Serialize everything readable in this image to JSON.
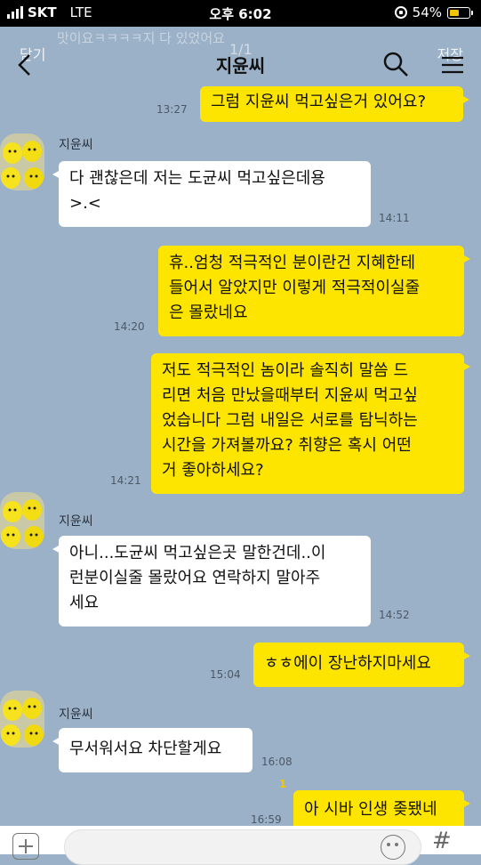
{
  "status_bar": {
    "carrier": "SKT",
    "network": "LTE",
    "time": "오후 6:02",
    "battery_text": "54%",
    "battery_level": 0.54
  },
  "header": {
    "title": "지윤씨",
    "close_label": "닫기",
    "save_label": "저장",
    "counter": "1/1",
    "preview_text": "맛이요ㅋㅋㅋㅋ지 다 있었어요"
  },
  "contact": {
    "name": "지윤씨"
  },
  "messages": [
    {
      "text": "그럼 지윤씨 먹고싶은거 있어요?",
      "time": "13:27"
    },
    {
      "sender": "지윤씨",
      "text": "다 괜찮은데 저는 도균씨 먹고싶은데용\n>.<",
      "time": "14:11"
    },
    {
      "text": "휴..엄청 적극적인 분이란건 지혜한테\n들어서 알았지만 이렇게 적극적이실줄\n은 몰랐네요",
      "time": "14:20"
    },
    {
      "text": "저도 적극적인 놈이라 솔직히 말씀 드\n리면 처음 만났을때부터 지윤씨 먹고싶\n었습니다 그럼 내일은 서로를 탐닉하는\n시간을 가져볼까요? 취향은 혹시 어떤\n거 좋아하세요?",
      "time": "14:21"
    },
    {
      "sender": "지윤씨",
      "text": "아니...도균씨 먹고싶은곳 말한건데..이\n런분이실줄 몰랐어요 연락하지 말아주\n세요",
      "time": "14:52"
    },
    {
      "text": "ㅎㅎ에이 장난하지마세요",
      "time": "15:04"
    },
    {
      "sender": "지윤씨",
      "text": "무서워서요 차단할게요",
      "time": "16:08"
    },
    {
      "text": "아 시바 인생 좆됐네",
      "time": "16:59",
      "unread": "1"
    }
  ],
  "colors": {
    "background": "#9bb1c8",
    "my_bubble": "#fee500",
    "other_bubble": "#ffffff",
    "unread": "#f2c600"
  },
  "icons": [
    "back-arrow-icon",
    "search-icon",
    "menu-icon",
    "plus-icon",
    "emoji-icon",
    "hash-icon"
  ]
}
